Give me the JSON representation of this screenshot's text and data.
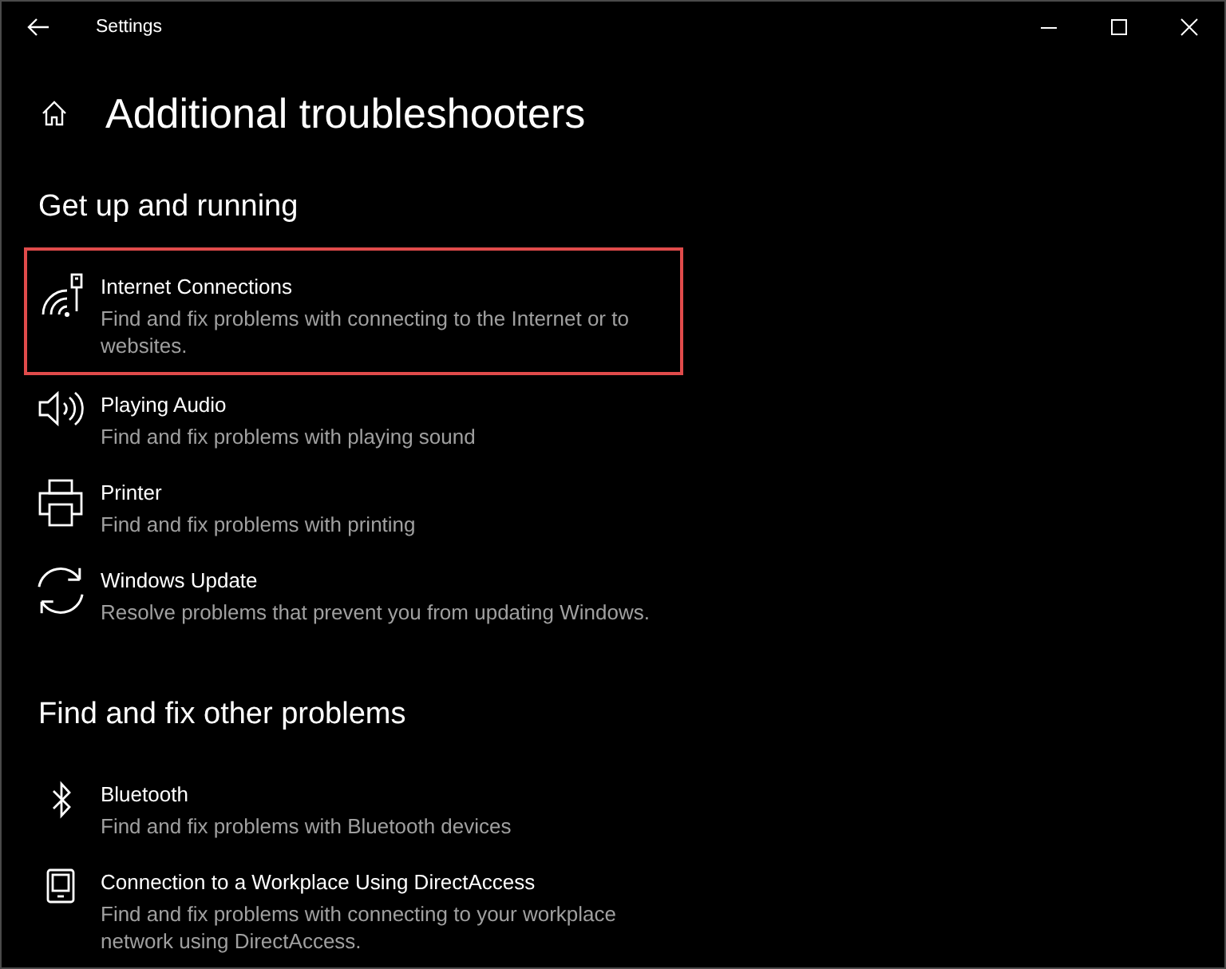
{
  "window": {
    "title": "Settings"
  },
  "page": {
    "title": "Additional troubleshooters"
  },
  "sections": [
    {
      "heading": "Get up and running",
      "items": [
        {
          "kind": "internet",
          "title": "Internet Connections",
          "description": "Find and fix problems with connecting to the Internet or to websites.",
          "highlighted": true
        },
        {
          "kind": "audio",
          "title": "Playing Audio",
          "description": "Find and fix problems with playing sound",
          "highlighted": false
        },
        {
          "kind": "printer",
          "title": "Printer",
          "description": "Find and fix problems with printing",
          "highlighted": false
        },
        {
          "kind": "update",
          "title": "Windows Update",
          "description": "Resolve problems that prevent you from updating Windows.",
          "highlighted": false
        }
      ]
    },
    {
      "heading": "Find and fix other problems",
      "items": [
        {
          "kind": "bluetooth",
          "title": "Bluetooth",
          "description": "Find and fix problems with Bluetooth devices",
          "highlighted": false
        },
        {
          "kind": "phone",
          "title": "Connection to a Workplace Using DirectAccess",
          "description": "Find and fix problems with connecting to your workplace network using DirectAccess.",
          "highlighted": false
        }
      ]
    }
  ]
}
